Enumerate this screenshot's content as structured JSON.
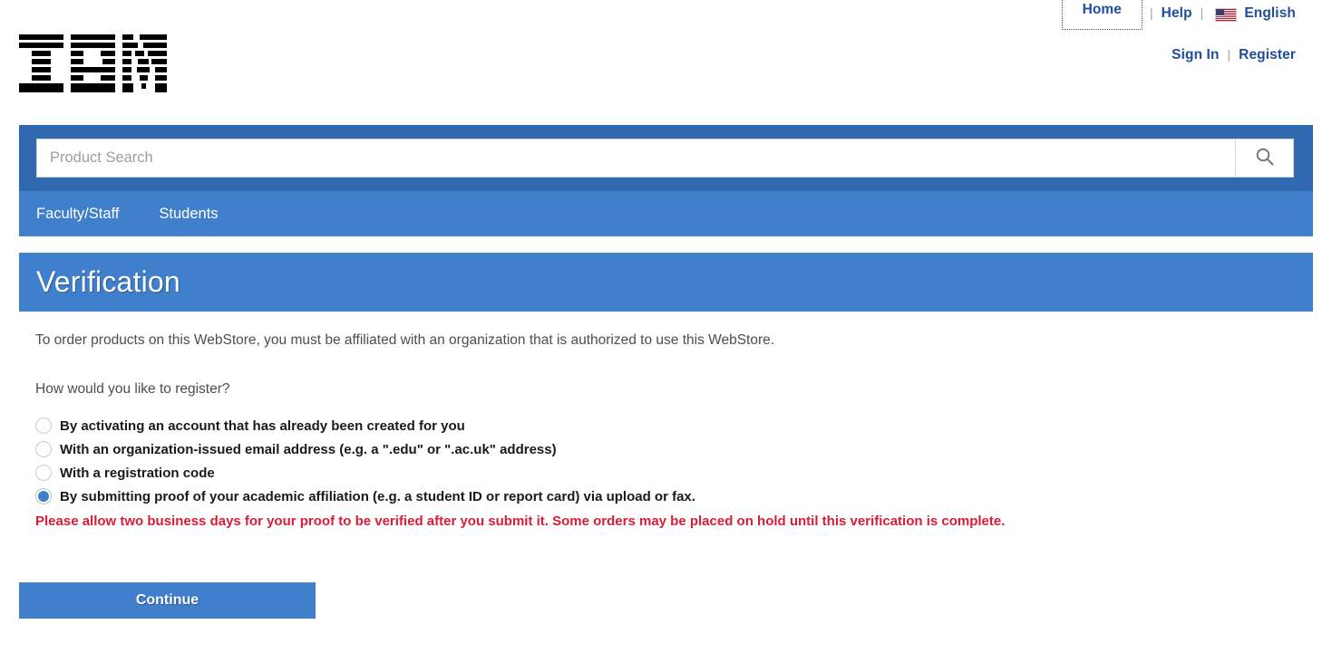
{
  "header": {
    "logo_alt": "IBM",
    "utility_row_1": [
      {
        "label": "Home",
        "name": "home-link",
        "focused": true
      },
      {
        "label": "Help",
        "name": "help-link",
        "focused": false
      }
    ],
    "language": {
      "label": "English",
      "flag": "us-flag-icon"
    },
    "utility_row_2": [
      {
        "label": "Sign In",
        "name": "sign-in-link"
      },
      {
        "label": "Register",
        "name": "register-link"
      }
    ],
    "separator": "|"
  },
  "search": {
    "placeholder": "Product Search",
    "value": "",
    "button_icon": "search-icon"
  },
  "nav": {
    "items": [
      {
        "label": "Faculty/Staff",
        "name": "nav-item-faculty-staff"
      },
      {
        "label": "Students",
        "name": "nav-item-students"
      }
    ]
  },
  "page": {
    "title": "Verification",
    "intro": "To order products on this WebStore, you must be affiliated with an organization that is authorized to use this WebStore.",
    "question": "How would you like to register?",
    "warning": "Please allow two business days for your proof to be verified after you submit it. Some orders may be placed on hold until this verification is complete.",
    "continue_label": "Continue"
  },
  "options": [
    {
      "label": "By activating an account that has already been created for you",
      "selected": false,
      "name": "radio-activate-account"
    },
    {
      "label": "With an organization-issued email address (e.g. a \".edu\" or \".ac.uk\" address)",
      "selected": false,
      "name": "radio-org-email"
    },
    {
      "label": "With a registration code",
      "selected": false,
      "name": "radio-registration-code"
    },
    {
      "label": "By submitting proof of your academic affiliation (e.g. a student ID or report card) via upload or fax.",
      "selected": true,
      "name": "radio-submit-proof"
    }
  ],
  "colors": {
    "band_dark": "#3169b0",
    "band_light": "#3f7fcc",
    "link": "#1f4e9c",
    "warning": "#d91c38"
  }
}
